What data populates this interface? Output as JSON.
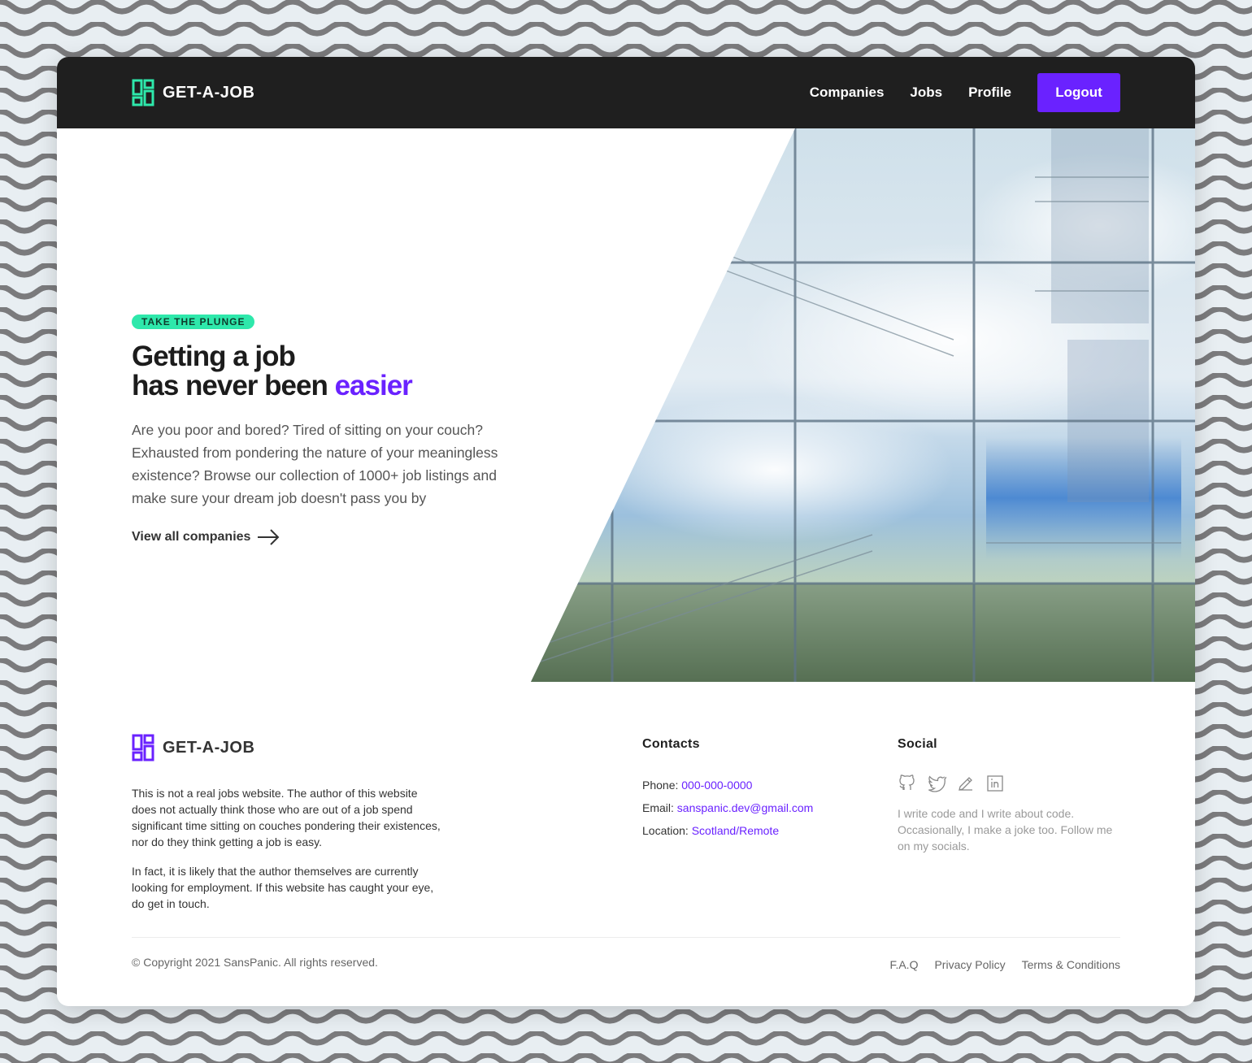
{
  "colors": {
    "accent": "#6a22ff",
    "brand_green": "#2ee8ab",
    "header_bg": "#1f1f1f"
  },
  "header": {
    "brand": "GET-A-JOB",
    "nav": [
      "Companies",
      "Jobs",
      "Profile"
    ],
    "logout_label": "Logout"
  },
  "hero": {
    "tag": "TAKE THE PLUNGE",
    "title_line1": "Getting a job",
    "title_line2": "has never been ",
    "title_accent": "easier",
    "description": "Are you poor and bored? Tired of sitting on your couch? Exhausted from pondering the nature of your meaningless existence? Browse our collection of 1000+ job listings and make sure your dream job doesn't pass you by",
    "cta_label": "View all companies"
  },
  "footer": {
    "brand": "GET-A-JOB",
    "about_1": "This is not a real jobs website. The author of this website does not actually think those who are out of a job spend significant time sitting on couches pondering their existences, nor do they think getting a job is easy.",
    "about_2": "In fact, it is likely that the author themselves are currently looking for employment. If this website has caught your eye, do get in touch.",
    "contacts_title": "Contacts",
    "contacts": [
      {
        "label": "Phone: ",
        "value": "000-000-0000"
      },
      {
        "label": "Email: ",
        "value": "sanspanic.dev@gmail.com"
      },
      {
        "label": "Location: ",
        "value": "Scotland/Remote"
      }
    ],
    "social_title": "Social",
    "social_icons": [
      "github-icon",
      "twitter-icon",
      "pencil-icon",
      "linkedin-icon"
    ],
    "social_text": "I write code and I write about code. Occasionally, I make a joke too. Follow me on my socials.",
    "copyright": "© Copyright 2021 SansPanic. All rights reserved.",
    "legal_links": [
      "F.A.Q",
      "Privacy Policy",
      "Terms & Conditions"
    ]
  }
}
